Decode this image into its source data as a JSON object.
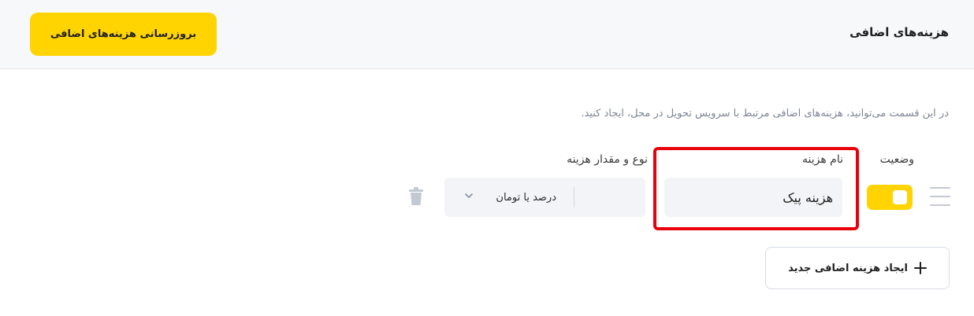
{
  "header": {
    "title": "هزینه‌های اضافی",
    "update_button": "بروزرسانی هزینه‌های اضافی"
  },
  "description": "در این قسمت می‌توانید، هزینه‌های اضافی مرتبط با سرویس تحویل در محل، ایجاد کنید.",
  "columns": {
    "status": "وضعیت",
    "name": "نام هزینه",
    "type": "نوع و مقدار هزینه"
  },
  "row": {
    "enabled": true,
    "name_value": "هزینه پیک",
    "type_selected": "درصد یا تومان",
    "amount_value": ""
  },
  "add_button": "ایجاد هزینه اضافی جدید",
  "colors": {
    "accent": "#ffd400",
    "highlight": "#e8000b"
  },
  "icons": [
    "drag-handle-icon",
    "chevron-down-icon",
    "trash-icon",
    "plus-icon"
  ]
}
